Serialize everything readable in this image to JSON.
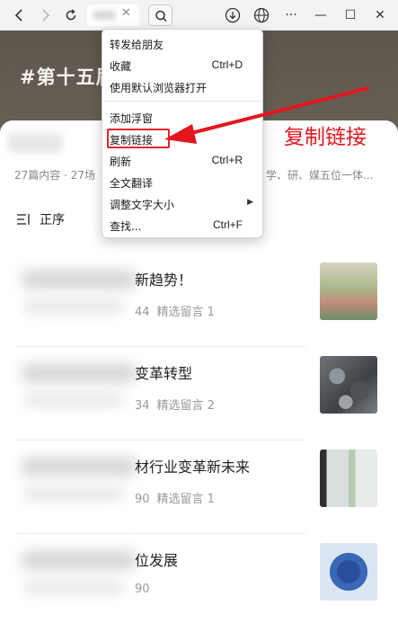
{
  "toolbar": {
    "back_icon": "arrow-left-icon",
    "forward_icon": "arrow-right-icon",
    "reload_icon": "reload-icon",
    "clear_icon": "close-icon",
    "search_icon": "search-icon",
    "download_icon": "download-icon",
    "translate_icon": "globe-icon",
    "more_label": "···",
    "minimize_label": "—",
    "maximize_label": "☐",
    "close_label": "✕"
  },
  "banner": {
    "title": "#第十五届                         会"
  },
  "account": {
    "stats": "27篇内容 · 27场",
    "stats_tail": "学、研、媒五位一体..."
  },
  "sort": {
    "icon": "sort-icon",
    "label": "正序"
  },
  "articles": [
    {
      "title": "新趋势！",
      "views": "44",
      "comments": "精选留言 1"
    },
    {
      "title": "变革转型",
      "views": "34",
      "comments": "精选留言 2"
    },
    {
      "title": "材行业变革新未来",
      "views": "90",
      "comments": "精选留言 1"
    },
    {
      "title": "位发展",
      "views": "90",
      "comments": ""
    }
  ],
  "context_menu": {
    "items": [
      {
        "label": "转发给朋友",
        "shortcut": ""
      },
      {
        "label": "收藏",
        "shortcut": "Ctrl+D"
      },
      {
        "label": "使用默认浏览器打开",
        "shortcut": ""
      },
      {
        "label": "添加浮窗",
        "shortcut": ""
      },
      {
        "label": "复制链接",
        "shortcut": ""
      },
      {
        "label": "刷新",
        "shortcut": "Ctrl+R"
      },
      {
        "label": "全文翻译",
        "shortcut": ""
      },
      {
        "label": "调整文字大小",
        "shortcut": ""
      },
      {
        "label": "查找...",
        "shortcut": "Ctrl+F"
      }
    ],
    "submenu_arrow": "▶"
  },
  "annotation": {
    "text": "复制链接",
    "color": "#e3161e"
  }
}
